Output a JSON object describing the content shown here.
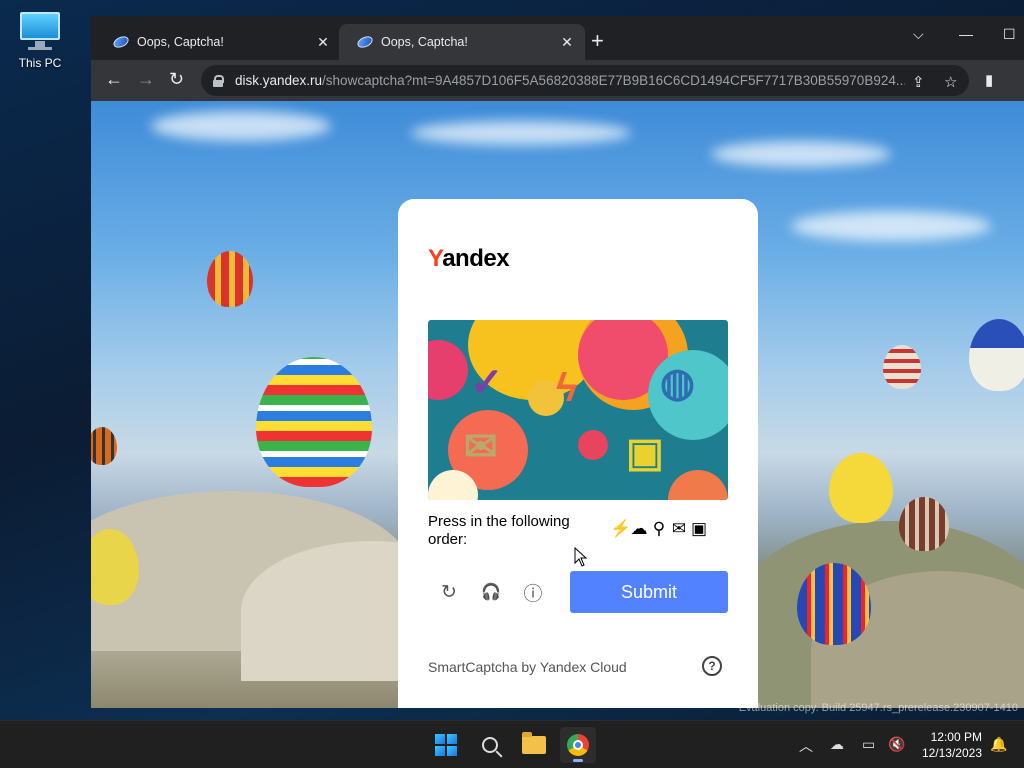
{
  "desktop": {
    "icons": [
      {
        "label": "This PC",
        "icon": "computer-icon"
      }
    ]
  },
  "browser": {
    "tabs": [
      {
        "title": "Oops, Captcha!",
        "active": false
      },
      {
        "title": "Oops, Captcha!",
        "active": true
      }
    ],
    "new_tab_symbol": "+",
    "address_bar": {
      "host": "disk.yandex.ru",
      "path": "/showcaptcha?mt=9A4857D106F5A56820388E77B9B16C6CD1494CF5F7717B30B55970B924..."
    }
  },
  "captcha": {
    "logo_first": "Y",
    "logo_rest": "andex",
    "instruction": "Press in the following order:",
    "order_icons": [
      "lightning-icon",
      "cloud-icon",
      "mushroom-icon",
      "envelope-icon",
      "film-icon"
    ],
    "order_glyphs": [
      "⚡",
      "☁",
      "⚲",
      "✉",
      "▣"
    ],
    "actions": {
      "refresh_glyph": "↻",
      "audio_glyph": "🎧",
      "info_glyph": "ⓘ"
    },
    "submit_label": "Submit",
    "footer": "SmartCaptcha by Yandex Cloud",
    "help_glyph": "?",
    "colors": {
      "submit": "#5282ff",
      "logo_accent": "#fc3f1d"
    }
  },
  "watermark": "Evaluation copy. Build 25947.rs_prerelease.230907-1410",
  "taskbar": {
    "apps": [
      "start-icon",
      "search-icon",
      "file-explorer-icon",
      "chrome-icon"
    ],
    "clock": {
      "time": "12:00 PM",
      "date": "12/13/2023"
    }
  }
}
